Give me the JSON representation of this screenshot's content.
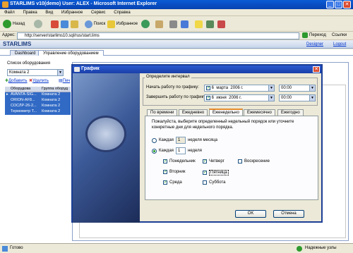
{
  "window": {
    "title": "STARLIMS v10(demo) User: ALEX - Microsoft Internet Explorer",
    "min": "_",
    "max": "□",
    "close": "✕"
  },
  "menu": [
    "Файл",
    "Правка",
    "Вид",
    "Избранное",
    "Сервис",
    "Справка"
  ],
  "toolbar": {
    "back": "Назад",
    "search": "Поиск",
    "favorites": "Избранное"
  },
  "address": {
    "label": "Адрес:",
    "url": "http://server/starlims10.sql/rus/start.lims",
    "go": "Переход",
    "links": "Ссылки"
  },
  "app": {
    "name": "STARLIMS",
    "designer": "Designer",
    "logout": "Logout"
  },
  "page_tabs": [
    "Dashboard",
    "Управление оборудованием"
  ],
  "sidebar": {
    "title": "Список оборудования",
    "select": "Комната 2",
    "add": "Добавить",
    "delete": "Удалить",
    "print": "Печ",
    "columns": [
      "Оборудова",
      "Группа оборуд"
    ],
    "rows": [
      [
        "AVANTA-SIG...",
        "Комната 2"
      ],
      [
        "ORION-AF8...",
        "Комната 2"
      ],
      [
        "СОСЛР-26-2...",
        "Комната 2"
      ],
      [
        "Термометр Т...",
        "Комната 2"
      ]
    ]
  },
  "dialog": {
    "title": "График",
    "interval_title": "Определите интервал",
    "start_label": "Начать работу по графику:",
    "start_day": "6",
    "start_month": "марта",
    "start_year": "2006 г.",
    "start_time": "00:00",
    "end_label": "Завершить работу по графику:",
    "end_day": "6",
    "end_month": "июня",
    "end_year": "2006 г.",
    "end_time": "00:00",
    "tabs": [
      "По времени",
      "Ежедневно",
      "Еженедельно",
      "Ежемесячно",
      "Ежегодно"
    ],
    "instruction": "Пожалуйста, выберите определенный недельный порядок или уточните конкретные дни для недельного порядка.",
    "option1_label": "Каждая",
    "option1_value": "1",
    "option1_suffix": "неделя месяца",
    "option2_label": "Каждая",
    "option2_value": "1",
    "option2_suffix": "неделя",
    "days": [
      {
        "label": "Понедельник",
        "checked": true
      },
      {
        "label": "Вторник",
        "checked": true
      },
      {
        "label": "Среда",
        "checked": true
      },
      {
        "label": "Четверг",
        "checked": true
      },
      {
        "label": "Пятница",
        "checked": true
      },
      {
        "label": "Суббота",
        "checked": false
      },
      {
        "label": "Воскресение",
        "checked": false
      }
    ],
    "ok": "OK",
    "cancel": "Отмена"
  },
  "status": {
    "left": "Готово",
    "right": "Надежные узлы"
  }
}
